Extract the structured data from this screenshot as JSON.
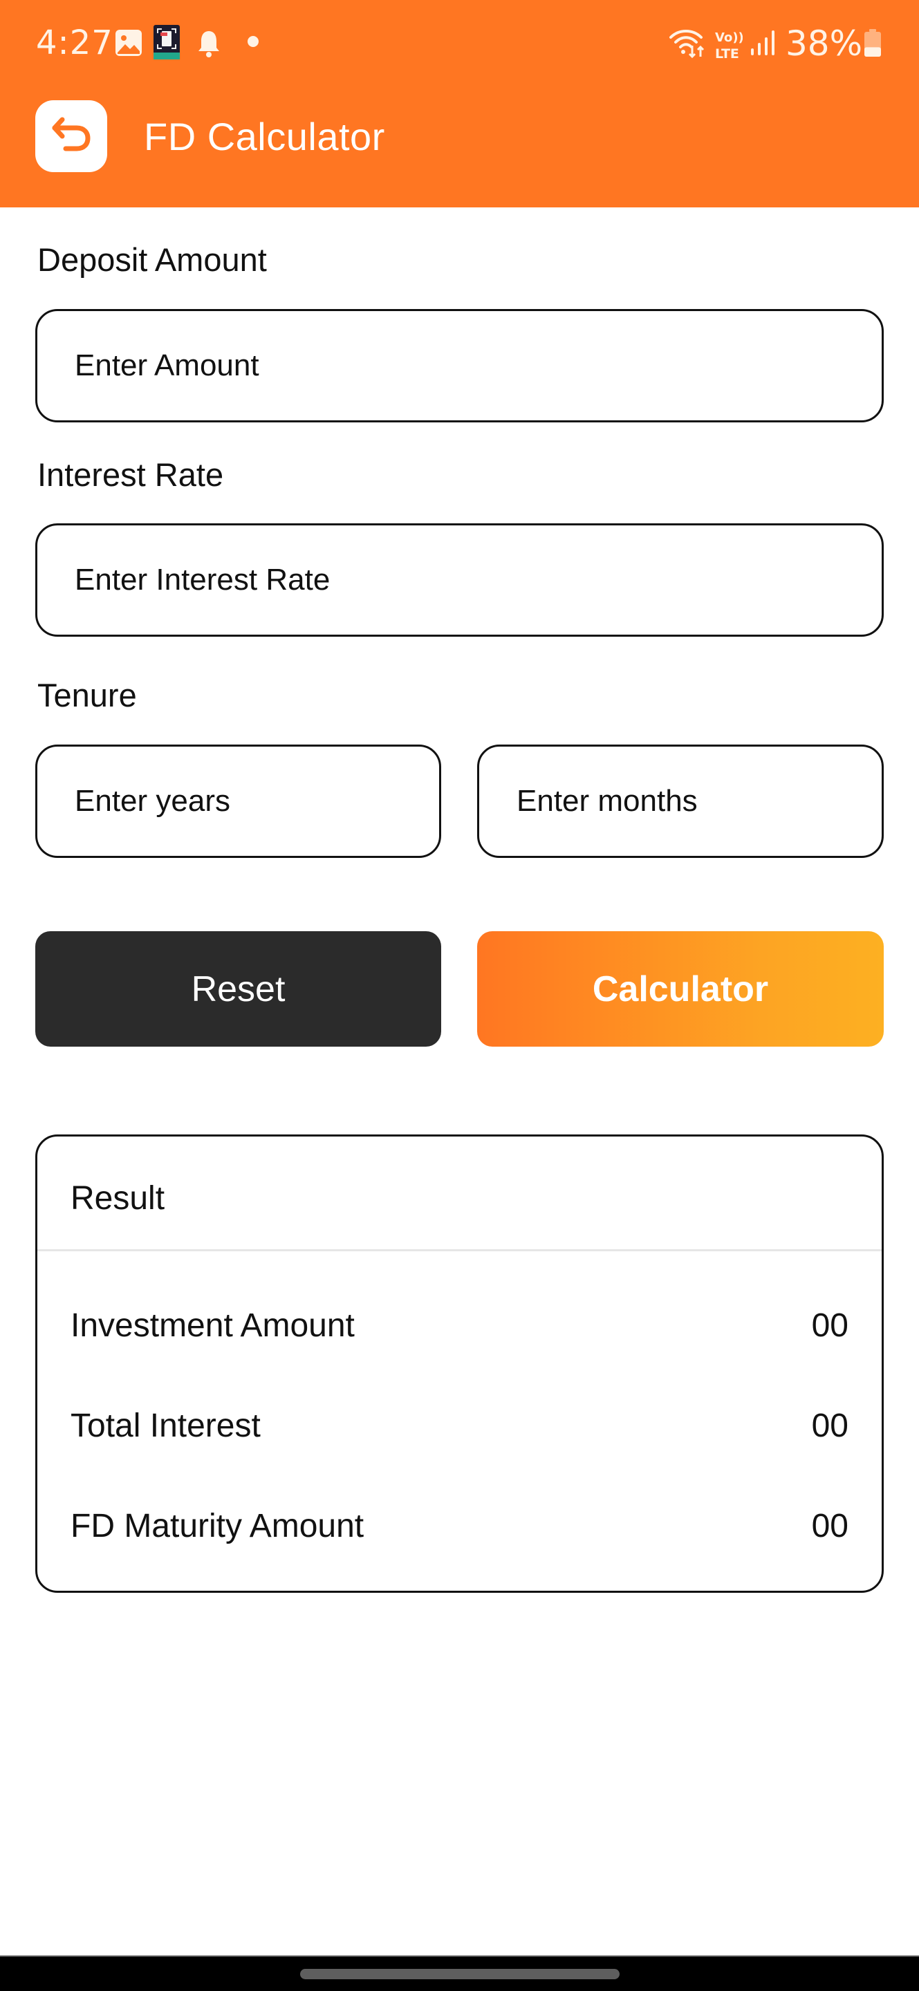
{
  "status_bar": {
    "time": "4:27",
    "left_icons": [
      "gallery-icon",
      "pdf-scanner-app-icon",
      "notification-bell-icon",
      "dot-icon"
    ],
    "right_icons": [
      "wifi-icon",
      "volte-lte-icon",
      "signal-icon",
      "battery-icon"
    ],
    "volte_top": "Vo))",
    "volte_bottom": "LTE",
    "battery_percent": "38%",
    "battery_level": 0.38
  },
  "app_bar": {
    "title": "FD Calculator",
    "back_icon": "back-arrow-icon"
  },
  "form": {
    "deposit": {
      "label": "Deposit Amount",
      "placeholder": "Enter Amount",
      "value": ""
    },
    "interest": {
      "label": "Interest Rate",
      "placeholder": "Enter Interest Rate",
      "value": ""
    },
    "tenure": {
      "label": "Tenure",
      "years_placeholder": "Enter years",
      "years_value": "",
      "months_placeholder": "Enter months",
      "months_value": ""
    }
  },
  "buttons": {
    "reset_label": "Reset",
    "calculate_label": "Calculator"
  },
  "result": {
    "title": "Result",
    "rows": [
      {
        "label": "Investment Amount",
        "value": "00"
      },
      {
        "label": "Total Interest",
        "value": "00"
      },
      {
        "label": "FD Maturity Amount",
        "value": "00"
      }
    ]
  },
  "colors": {
    "brand_orange": "#FF7622",
    "gradient_end": "#FDB022",
    "reset_button": "#2B2B2B",
    "border": "#111111",
    "divider": "#E6E6E6"
  }
}
